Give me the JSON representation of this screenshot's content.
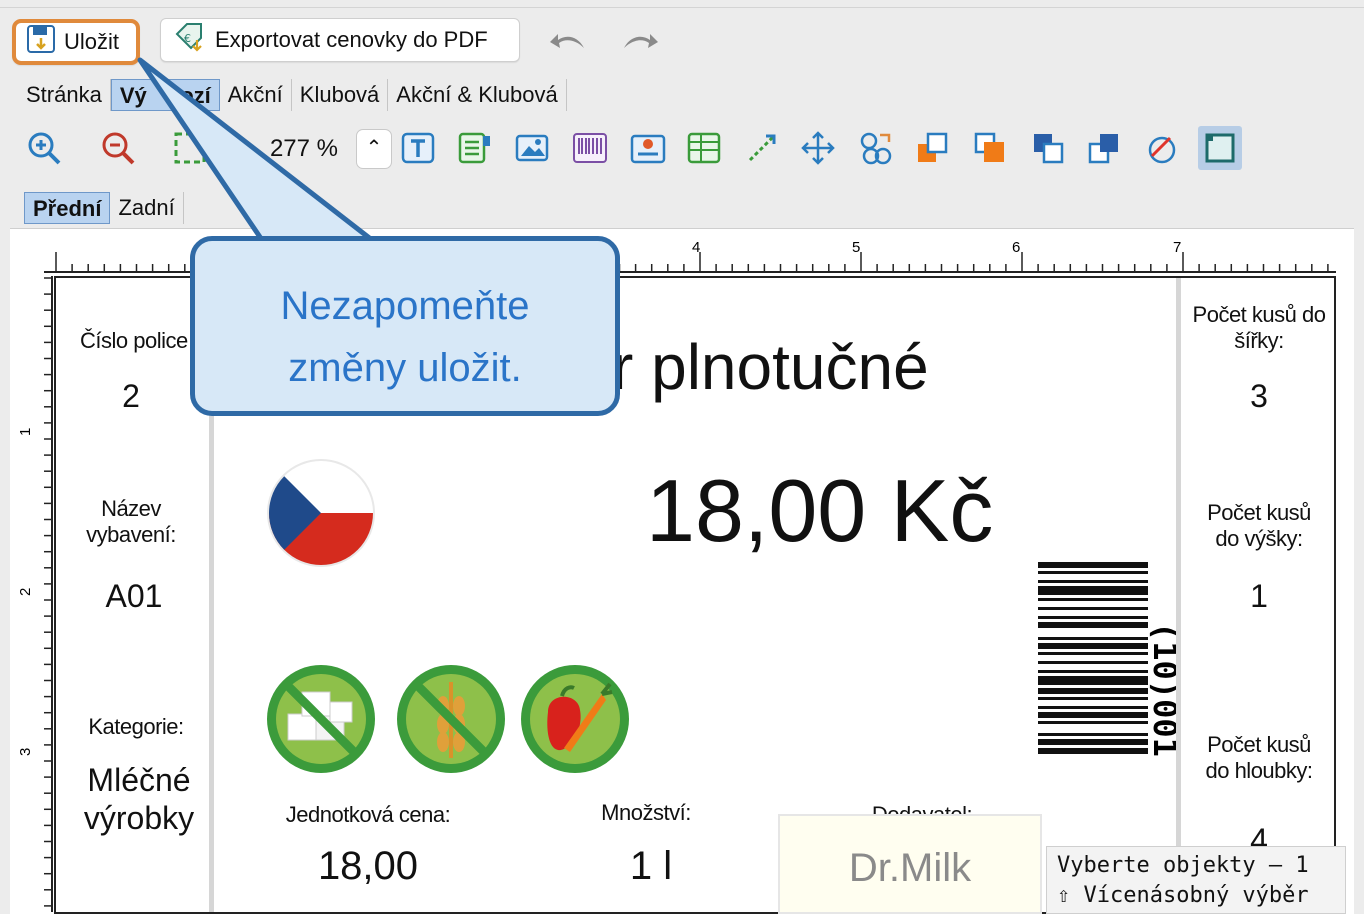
{
  "toolbar": {
    "save_label": "Uložit",
    "export_label": "Exportovat cenovky do PDF",
    "undo_icon": "undo-arrow-icon",
    "redo_icon": "redo-arrow-icon",
    "zoom_value": "277 %"
  },
  "tabs": [
    "Stránka",
    "Výchozí",
    "Akční",
    "Klubová",
    "Akční & Klubová"
  ],
  "active_tab": "Výchozí",
  "tab_visible_fragments": {
    "vychozi_left": "Vý",
    "vychozi_right": "hozí"
  },
  "subtabs": [
    "Přední",
    "Zadní"
  ],
  "active_subtab": "Přední",
  "ruler": {
    "h_numbers": [
      "4",
      "5",
      "6",
      "7"
    ],
    "v_numbers": [
      "1",
      "2",
      "3"
    ]
  },
  "label": {
    "left": {
      "shelf_label": "Číslo police",
      "shelf_value": "2",
      "equipment_label_1": "Název",
      "equipment_label_2": "vybavení:",
      "equipment_value": "A01",
      "category_label": "Kategorie:",
      "category_value_1": "Mléčné",
      "category_value_2": "výrobky"
    },
    "product_name_fragment": "r plnotučné",
    "price": "18,00 Kč",
    "unit_price_label": "Jednotková cena:",
    "unit_price_value": "18,00",
    "quantity_label": "Množství:",
    "quantity_value": "1 l",
    "supplier_label": "Dodavatel:",
    "supplier_value": "Dr.Milk",
    "barcode_text": "(10)001",
    "right": {
      "width_label_1": "Počet kusů do",
      "width_label_2": "šířky:",
      "width_value": "3",
      "height_label_1": "Počet kusů",
      "height_label_2": "do výšky:",
      "height_value": "1",
      "depth_label_1": "Počet kusů",
      "depth_label_2": "do hloubky:",
      "depth_value": "4"
    }
  },
  "callout": {
    "line1": "Nezapomeňte",
    "line2": "změny uložit."
  },
  "tooltip": {
    "line1": "Vyberte objekty – 1",
    "line2": "⇧ Vícenásobný výběr"
  },
  "colors": {
    "accent_blue": "#2a74c8",
    "highlight_orange": "#e08a3c",
    "icon_green": "#3a9b3a",
    "flag_blue": "#1f4a8a",
    "flag_red": "#d52b1e"
  },
  "icons": [
    "zoom-in-icon",
    "zoom-out-icon",
    "fit-page-icon",
    "text-box-icon",
    "list-icon",
    "image-icon",
    "barcode-icon",
    "map-pin-icon",
    "table-icon",
    "resize-icon",
    "move-icon",
    "group-icon",
    "bring-forward-icon",
    "bring-to-front-icon",
    "send-backward-icon",
    "send-to-back-icon",
    "rotate-icon",
    "frame-icon"
  ]
}
